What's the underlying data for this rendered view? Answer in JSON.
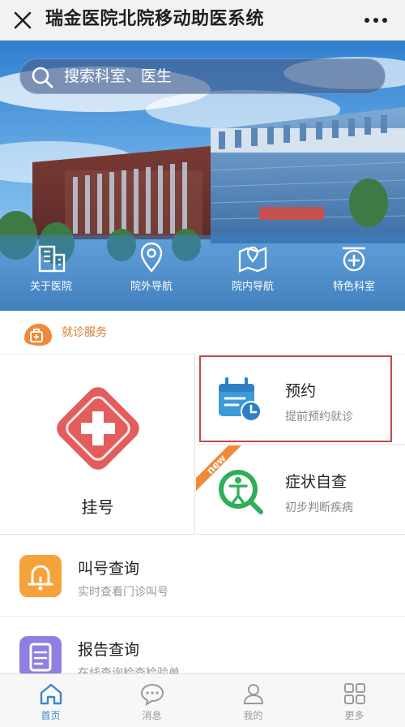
{
  "header": {
    "title": "瑞金医院北院移动助医系统"
  },
  "search": {
    "placeholder": "搜索科室、医生"
  },
  "quick_links": [
    {
      "label": "关于医院",
      "icon": "hospital-building-icon"
    },
    {
      "label": "院外导航",
      "icon": "map-pin-icon"
    },
    {
      "label": "院内导航",
      "icon": "indoor-map-icon"
    },
    {
      "label": "特色科室",
      "icon": "medical-kit-icon"
    }
  ],
  "section": {
    "title": "就诊服务",
    "icon": "service-bag-icon"
  },
  "services": {
    "guahao": {
      "label": "挂号",
      "icon": "red-cross-icon"
    },
    "yuyue": {
      "title": "预约",
      "subtitle": "提前预约就诊",
      "icon": "calendar-clock-icon"
    },
    "zhengzhuang": {
      "title": "症状自查",
      "subtitle": "初步判断疾病",
      "badge": "new",
      "icon": "person-search-icon"
    }
  },
  "rows": [
    {
      "title": "叫号查询",
      "subtitle": "实时查看门诊叫号",
      "icon": "bell-icon"
    },
    {
      "title": "报告查询",
      "subtitle": "在线查询检查检验单",
      "icon": "clipboard-icon"
    }
  ],
  "tabs": [
    {
      "label": "首页",
      "icon": "home-icon",
      "active": true
    },
    {
      "label": "消息",
      "icon": "chat-icon",
      "active": false
    },
    {
      "label": "我的",
      "icon": "user-icon",
      "active": false
    },
    {
      "label": "更多",
      "icon": "grid-icon",
      "active": false
    }
  ],
  "colors": {
    "accent": "#3c86c8",
    "orange": "#e8852f",
    "red": "#e25b5b",
    "green": "#2fae5a",
    "highlight_border": "#c24a4a"
  }
}
